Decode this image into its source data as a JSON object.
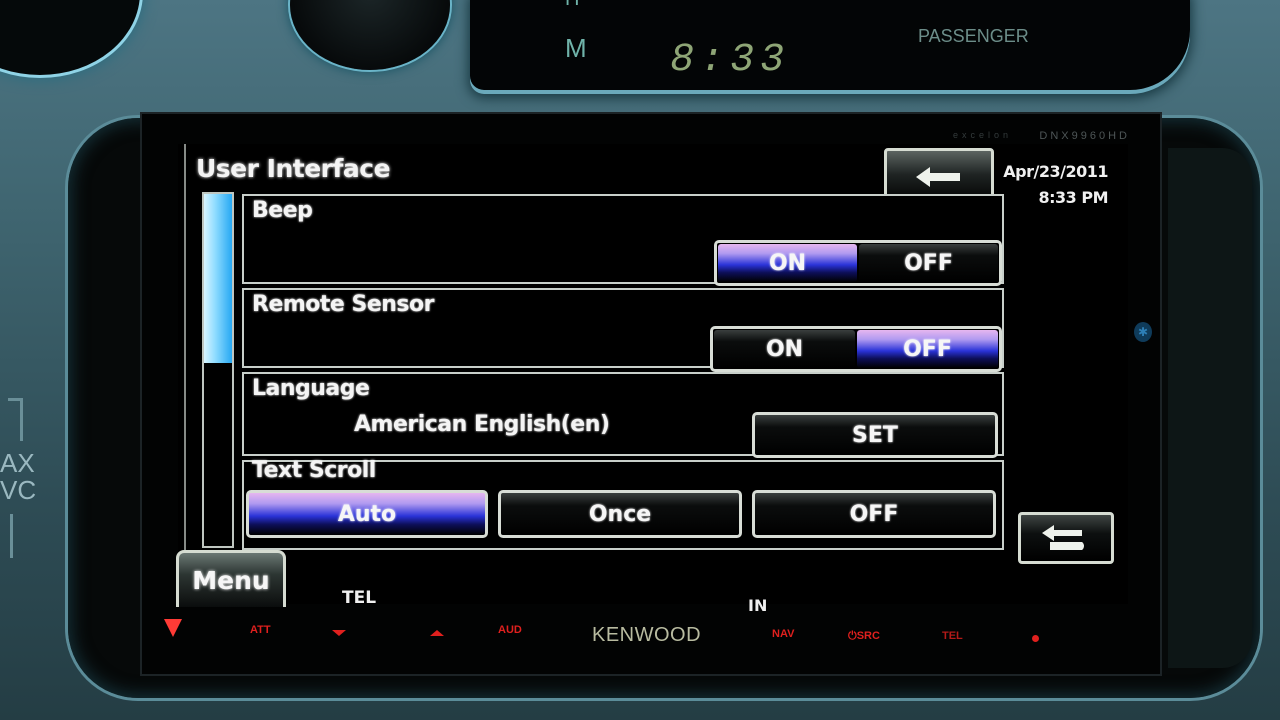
{
  "dashboard": {
    "cluster_h": "H",
    "cluster_m": "M",
    "cluster_clock": "8:33",
    "cluster_passenger": "PASSENGER",
    "side_text": "AX\nVC"
  },
  "device": {
    "model_label": "DNX9960HD",
    "series_label": "excelon",
    "brand": "KENWOOD"
  },
  "screen": {
    "title": "User Interface",
    "date": "Apr/23/2011",
    "time": "8:33 PM",
    "back_icon": "back-arrow-icon",
    "return_icon": "return-icon",
    "bluetooth_icon": "bluetooth-icon",
    "scroll_position_fraction": 0.48
  },
  "settings": {
    "beep": {
      "label": "Beep",
      "options": [
        "ON",
        "OFF"
      ],
      "selected": "ON"
    },
    "remote_sensor": {
      "label": "Remote Sensor",
      "options": [
        "ON",
        "OFF"
      ],
      "selected": "OFF"
    },
    "language": {
      "label": "Language",
      "value": "American English(en)",
      "button": "SET"
    },
    "text_scroll": {
      "label": "Text Scroll",
      "options": [
        "Auto",
        "Once",
        "OFF"
      ],
      "selected": "Auto"
    }
  },
  "bottom": {
    "menu": "Menu",
    "tel": "TEL",
    "in": "IN"
  },
  "hardware_keys": {
    "att": "ATT",
    "aud": "AUD",
    "nav": "NAV",
    "src": "⏻SRC",
    "tel": "TEL",
    "accent_color": "#e0201e"
  }
}
